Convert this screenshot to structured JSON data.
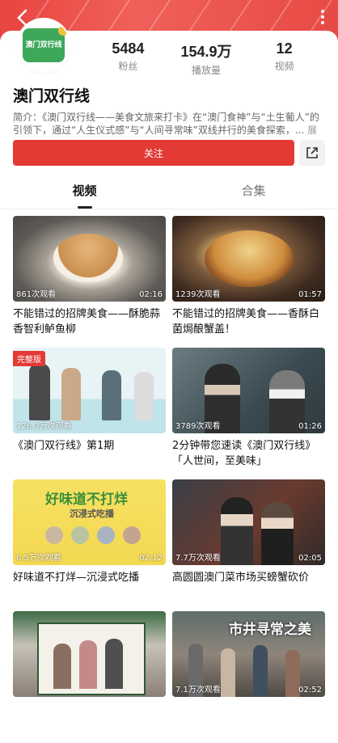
{
  "header": {
    "back_icon": "chevron-left-icon",
    "more_icon": "more-vertical-icon"
  },
  "profile": {
    "avatar_text": "澳门双行线",
    "name": "澳门双行线",
    "stats": [
      {
        "value": "5484",
        "label": "粉丝"
      },
      {
        "value": "154.9万",
        "label": "播放量"
      },
      {
        "value": "12",
        "label": "视频"
      }
    ],
    "intro": "简介：《澳门双行线——美食文旅来打卡》在“澳门食神”与“土生葡人”的引领下，通过“人生仪式感”与“人间寻常味”双线并行的美食探索，...",
    "expand": "展开",
    "follow_label": "关注",
    "share_icon": "share-icon"
  },
  "tabs": [
    {
      "label": "视频",
      "active": true
    },
    {
      "label": "合集",
      "active": false
    }
  ],
  "videos": [
    {
      "views": "861次观看",
      "duration": "02:16",
      "title": "不能错过的招牌美食——酥脆蒜香智利鲈鱼柳"
    },
    {
      "views": "1239次观看",
      "duration": "01:57",
      "title": "不能错过的招牌美食——香酥白菌焗酿蟹盖！"
    },
    {
      "badge": "完整版",
      "views": "126.3万次观看",
      "duration": "",
      "title": "《澳门双行线》第1期"
    },
    {
      "views": "3789次观看",
      "duration": "01:26",
      "title": "2分钟带您速读《澳门双行线》「人世间，至美味」"
    },
    {
      "views": "6.5万次观看",
      "duration": "02:12",
      "title": "好味道不打烊—沉浸式吃播",
      "caption_big": "好味道不打烊",
      "caption_small": "沉浸式吃播"
    },
    {
      "views": "7.7万次观看",
      "duration": "02:05",
      "title": "高圆圆澳门菜市场买螃蟹砍价"
    },
    {
      "views": "",
      "duration": "",
      "title": ""
    },
    {
      "views": "7.1万次观看",
      "duration": "02:52",
      "title": "",
      "caption_big": "市井寻常之美"
    }
  ]
}
